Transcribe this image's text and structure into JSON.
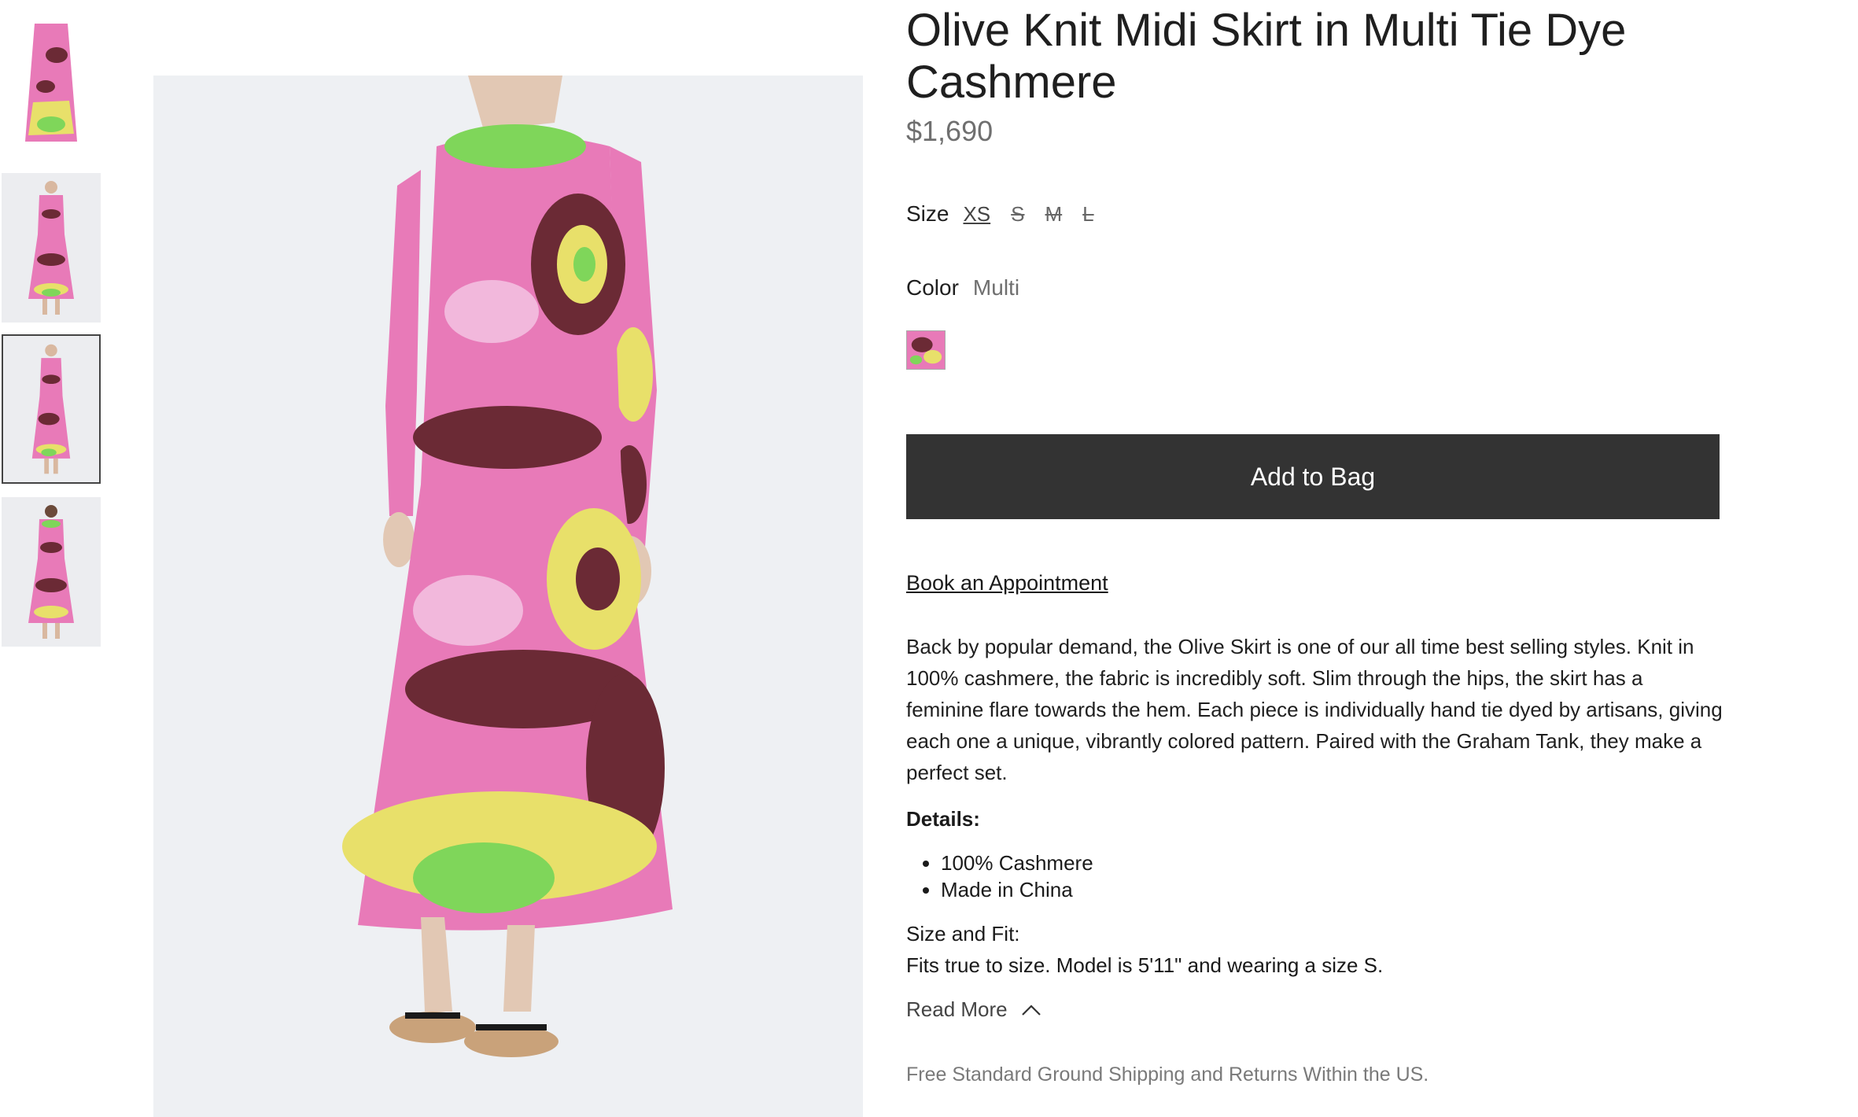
{
  "product": {
    "title": "Olive Knit Midi Skirt in Multi Tie Dye Cashmere",
    "price": "$1,690"
  },
  "size": {
    "label": "Size",
    "options": [
      {
        "label": "XS",
        "state": "selected"
      },
      {
        "label": "S",
        "state": "unavailable"
      },
      {
        "label": "M",
        "state": "unavailable"
      },
      {
        "label": "L",
        "state": "unavailable"
      }
    ]
  },
  "color": {
    "label": "Color",
    "value": "Multi"
  },
  "actions": {
    "add_to_bag": "Add to Bag",
    "book_appointment": "Book an Appointment",
    "read_more": "Read More"
  },
  "description": "Back by popular demand, the Olive Skirt is one of our all time best selling styles. Knit in 100% cashmere, the fabric is incredibly soft. Slim through the hips, the skirt has a feminine flare towards the hem. Each piece is individually hand tie dyed by artisans, giving each one a unique, vibrantly colored pattern. Paired with the Graham Tank, they make a perfect set.",
  "details": {
    "heading": "Details:",
    "items": [
      "100% Cashmere",
      "Made in China"
    ]
  },
  "size_fit": {
    "heading": "Size and Fit:",
    "text": "Fits true to size. Model is 5'11\" and wearing a size S."
  },
  "shipping_note": "Free Standard Ground Shipping and Returns Within the US.",
  "colors": {
    "button_bg": "#333333",
    "pink": "#e87ab8",
    "maroon": "#6b2a35",
    "lime": "#7fd65a",
    "yellow": "#e8e06a"
  },
  "icons": {
    "read_more": "chevron-up-icon"
  }
}
